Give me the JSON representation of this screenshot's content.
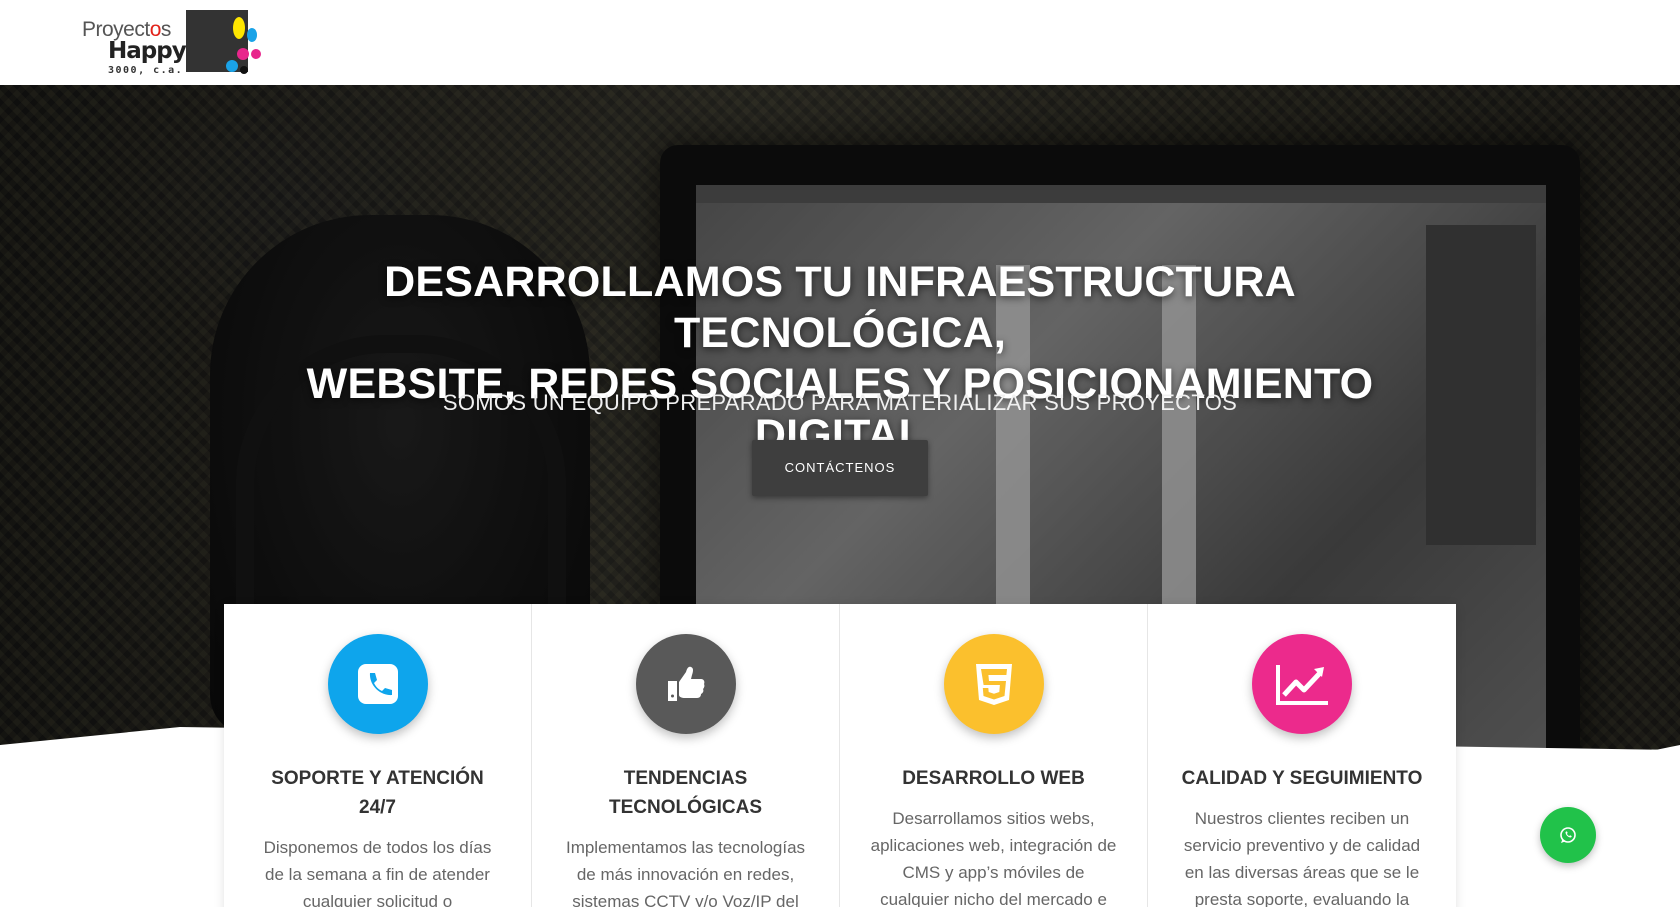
{
  "header": {
    "logo": {
      "line1": "Proyect",
      "line1_dot": "o",
      "line1_end": "s",
      "line2": "Happy",
      "line3": "3000, c.a."
    }
  },
  "hero": {
    "title_line1": "DESARROLLAMOS TU INFRAESTRUCTURA TECNOLÓGICA,",
    "title_line2": "WEBSITE, REDES SOCIALES Y POSICIONAMIENTO DIGITAL",
    "subtitle": "SOMOS UN EQUIPO PREPARADO PARA MATERIALIZAR SUS PROYECTOS",
    "button_label": "CONTÁCTENOS"
  },
  "services": [
    {
      "title": "SOPORTE Y ATENCIÓN 24/7",
      "text": "Disponemos de todos los días de la semana a fin de atender cualquier solicitud o inconveniente que se presente a",
      "icon": "phone-icon",
      "color": "#0ea5ec"
    },
    {
      "title": "TENDENCIAS TECNOLÓGICAS",
      "text": "Implementamos las tecnologías de más innovación en redes, sistemas CCTV y/o Voz/IP del",
      "icon": "thumbs-up-icon",
      "color": "#595959"
    },
    {
      "title": "DESARROLLO WEB",
      "text": "Desarrollamos sitios webs, aplicaciones web, integración de CMS y app’s móviles de cualquier nicho del mercado e",
      "icon": "html5-icon",
      "color": "#fbc02d"
    },
    {
      "title": "CALIDAD Y SEGUIMIENTO",
      "text": "Nuestros clientes reciben un servicio preventivo y de calidad en las diversas áreas que se le presta soporte, evaluando la",
      "icon": "line-chart-icon",
      "color": "#ec2a8c"
    }
  ],
  "whatsapp": {
    "icon": "whatsapp-icon",
    "color": "#21c24a"
  }
}
